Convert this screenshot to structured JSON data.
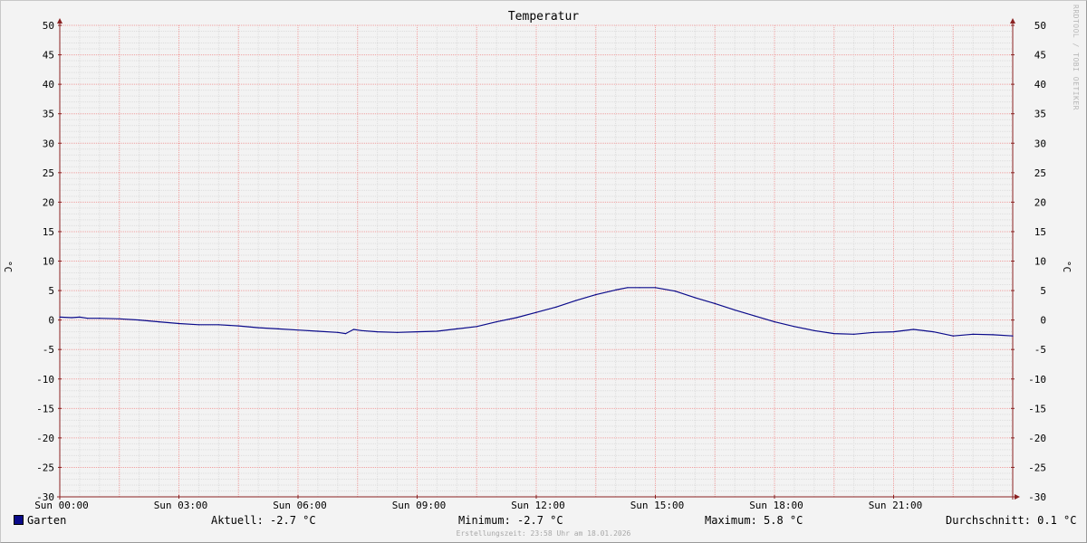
{
  "watermark": "RRDTOOL / TOBI OETIKER",
  "legend": {
    "series_label": "Garten",
    "current": "Aktuell: -2.7 °C",
    "minimum": "Minimum: -2.7 °C",
    "maximum": "Maximum: 5.8 °C",
    "average": "Durchschnitt: 0.1 °C"
  },
  "footer": "Erstellungszeit: 23:58 Uhr am 18.01.2026",
  "colors": {
    "line": "#0a0a8a",
    "major_grid": "#f0a0a0",
    "minor_grid": "#dddddd",
    "axis": "#8b2222"
  },
  "chart_data": {
    "type": "line",
    "title": "Temperatur",
    "ylabel": "°C",
    "ylabel_right": "°C",
    "xlim": [
      0,
      24
    ],
    "ylim": [
      -30,
      50
    ],
    "y_ticks": [
      -30,
      -25,
      -20,
      -15,
      -10,
      -5,
      0,
      5,
      10,
      15,
      20,
      25,
      30,
      35,
      40,
      45,
      50
    ],
    "x_ticks": [
      {
        "hour": 0,
        "label": "Sun 00:00"
      },
      {
        "hour": 3,
        "label": "Sun 03:00"
      },
      {
        "hour": 6,
        "label": "Sun 06:00"
      },
      {
        "hour": 9,
        "label": "Sun 09:00"
      },
      {
        "hour": 12,
        "label": "Sun 12:00"
      },
      {
        "hour": 15,
        "label": "Sun 15:00"
      },
      {
        "hour": 18,
        "label": "Sun 18:00"
      },
      {
        "hour": 21,
        "label": "Sun 21:00"
      }
    ],
    "grid": true,
    "legend_position": "bottom",
    "series": [
      {
        "name": "Garten",
        "x": [
          0,
          0.3,
          0.5,
          0.7,
          1,
          1.5,
          2,
          2.5,
          3,
          3.5,
          4,
          4.5,
          5,
          5.5,
          6,
          6.5,
          7,
          7.2,
          7.4,
          7.6,
          8,
          8.5,
          9,
          9.5,
          10,
          10.5,
          11,
          11.5,
          12,
          12.5,
          13,
          13.5,
          14,
          14.3,
          14.6,
          15,
          15.5,
          16,
          16.5,
          17,
          17.5,
          18,
          18.5,
          19,
          19.5,
          20,
          20.5,
          21,
          21.5,
          22,
          22.5,
          23,
          23.5,
          24
        ],
        "y": [
          0.5,
          0.4,
          0.5,
          0.3,
          0.3,
          0.2,
          0,
          -0.3,
          -0.6,
          -0.8,
          -0.8,
          -1,
          -1.3,
          -1.5,
          -1.7,
          -1.9,
          -2.1,
          -2.3,
          -1.6,
          -1.8,
          -2,
          -2.1,
          -2,
          -1.9,
          -1.5,
          -1.1,
          -0.3,
          0.4,
          1.3,
          2.2,
          3.3,
          4.3,
          5.1,
          5.5,
          5.5,
          5.5,
          4.9,
          3.8,
          2.8,
          1.7,
          0.7,
          -0.3,
          -1.1,
          -1.8,
          -2.3,
          -2.4,
          -2.1,
          -2,
          -1.6,
          -2,
          -2.7,
          -2.4,
          -2.5,
          -2.7
        ]
      }
    ]
  }
}
